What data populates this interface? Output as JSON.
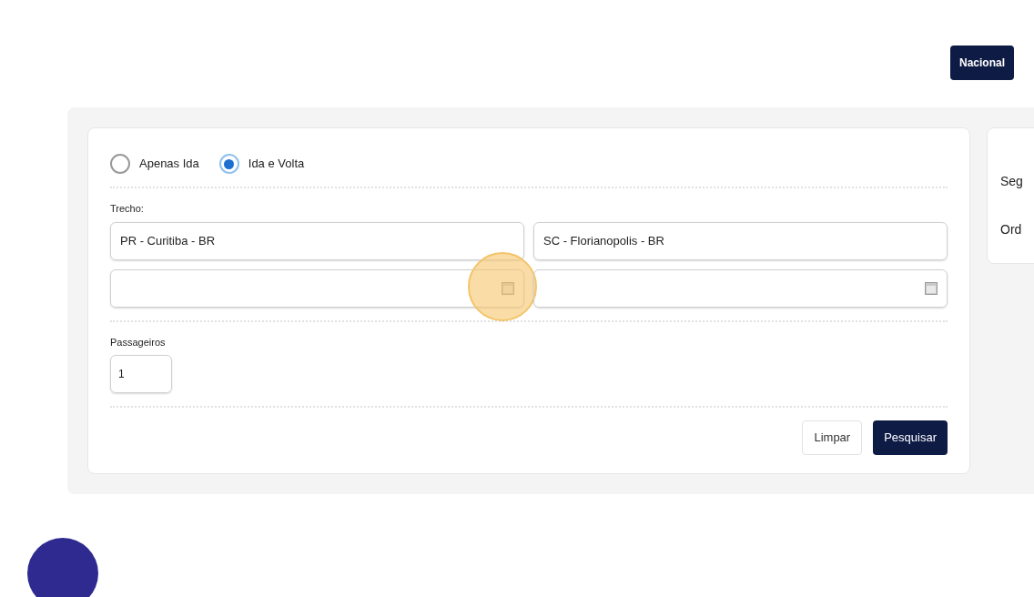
{
  "top_button": "Nacional",
  "trip_type": [
    {
      "label": "Apenas Ida",
      "selected": false
    },
    {
      "label": "Ida e Volta",
      "selected": true
    }
  ],
  "route_label": "Trecho:",
  "origin": {
    "value": "PR - Curitiba - BR"
  },
  "destination": {
    "value": "SC - Florianopolis - BR"
  },
  "dates": [
    {
      "highlighted": true
    },
    {
      "highlighted": false
    }
  ],
  "passengers_label": "Passageiros",
  "passengers": {
    "value": "1"
  },
  "actions": [
    {
      "label": "Limpar",
      "kind": "secondary"
    },
    {
      "label": "Pesquisar",
      "kind": "primary"
    }
  ],
  "side_card": {
    "lines": [
      "Seg",
      "Ord"
    ]
  }
}
